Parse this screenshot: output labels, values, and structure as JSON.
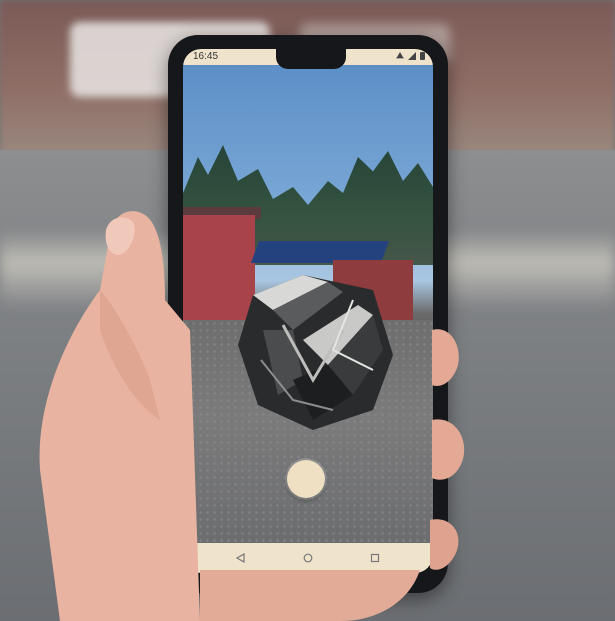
{
  "statusbar": {
    "time": "16:45",
    "icons": [
      "notification-muted-icon",
      "signal-icon",
      "battery-icon"
    ]
  },
  "camera": {
    "mode": "AR view",
    "shutter_icon": "shutter-button"
  },
  "navbar": {
    "back_icon": "back-triangle-icon",
    "home_icon": "home-circle-icon",
    "recents_icon": "recents-square-icon"
  },
  "colors": {
    "bar_background": "#f0e3cc",
    "shutter": "#efe0c4",
    "phone_body": "#15171a"
  }
}
